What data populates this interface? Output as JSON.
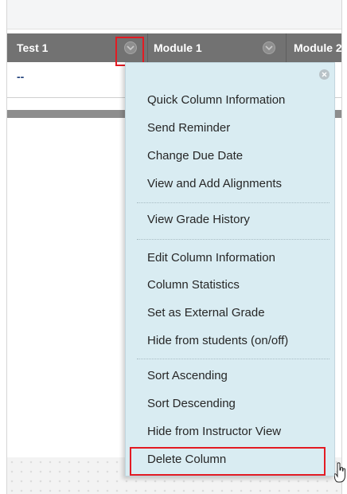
{
  "grid": {
    "columns": [
      "Test 1",
      "Module 1",
      "Module 2"
    ],
    "row_values": [
      "--"
    ]
  },
  "context_menu": {
    "groups": [
      [
        "Quick Column Information",
        "Send Reminder",
        "Change Due Date",
        "View and Add Alignments"
      ],
      [
        "View Grade History"
      ],
      [
        "Edit Column Information",
        "Column Statistics",
        "Set as External Grade",
        "Hide from students (on/off)"
      ],
      [
        "Sort Ascending",
        "Sort Descending",
        "Hide from Instructor View",
        "Delete Column"
      ]
    ],
    "highlighted_item": "Delete Column"
  },
  "icons": {
    "column_menu_button": "chevron-down-circle-icon",
    "menu_close": "close-circle-icon",
    "pointer": "hand-cursor-icon"
  },
  "colors": {
    "header_bg": "#727272",
    "menu_bg": "#d9ecf2",
    "highlight_box": "#e31b23",
    "value_text": "#1f3f7a"
  }
}
